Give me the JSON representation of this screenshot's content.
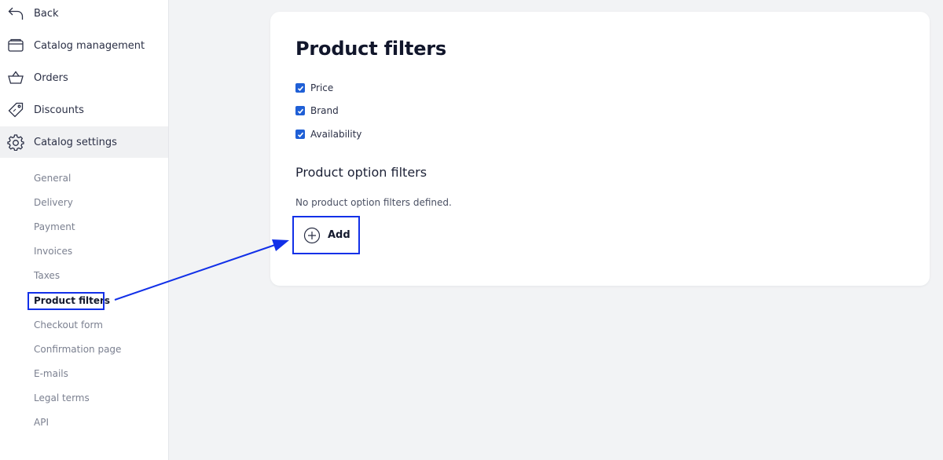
{
  "sidebar": {
    "items": [
      {
        "label": "Back",
        "icon": "back-arrow-icon"
      },
      {
        "label": "Catalog management",
        "icon": "folder-icon"
      },
      {
        "label": "Orders",
        "icon": "basket-icon"
      },
      {
        "label": "Discounts",
        "icon": "tag-icon"
      },
      {
        "label": "Catalog settings",
        "icon": "gear-icon"
      }
    ],
    "subitems": [
      "General",
      "Delivery",
      "Payment",
      "Invoices",
      "Taxes",
      "Product filters",
      "Checkout form",
      "Confirmation page",
      "E-mails",
      "Legal terms",
      "API"
    ]
  },
  "main": {
    "title": "Product filters",
    "filters": [
      {
        "label": "Price",
        "checked": true
      },
      {
        "label": "Brand",
        "checked": true
      },
      {
        "label": "Availability",
        "checked": true
      }
    ],
    "option_section_title": "Product option filters",
    "empty_message": "No product option filters defined.",
    "add_label": "Add"
  },
  "colors": {
    "accent": "#1f5fd6",
    "highlight": "#1230e8"
  }
}
